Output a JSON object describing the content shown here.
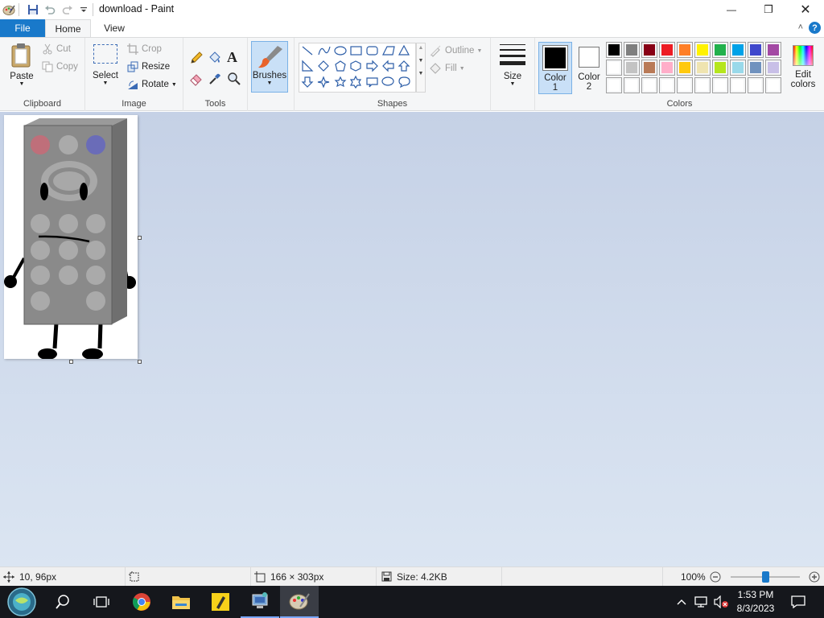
{
  "window": {
    "title": "download - Paint",
    "minimize_glyph": "—",
    "maximize_glyph": "❐",
    "close_glyph": "✕"
  },
  "tabs": {
    "file": "File",
    "home": "Home",
    "view": "View",
    "help": "?",
    "collapse": "˄"
  },
  "ribbon": {
    "clipboard": {
      "label": "Clipboard",
      "paste": "Paste",
      "cut": "Cut",
      "copy": "Copy"
    },
    "image": {
      "label": "Image",
      "select": "Select",
      "crop": "Crop",
      "resize": "Resize",
      "rotate": "Rotate"
    },
    "tools": {
      "label": "Tools"
    },
    "brushes": {
      "label": "Brushes"
    },
    "shapes": {
      "label": "Shapes",
      "outline": "Outline",
      "fill": "Fill"
    },
    "size": {
      "label": "Size"
    },
    "color1": {
      "line1": "Color",
      "line2": "1",
      "value": "#000000"
    },
    "color2": {
      "line1": "Color",
      "line2": "2",
      "value": "#ffffff"
    },
    "colors": {
      "label": "Colors"
    },
    "edit_colors": {
      "line1": "Edit",
      "line2": "colors"
    }
  },
  "palette": {
    "row1": [
      "#000000",
      "#7f7f7f",
      "#880015",
      "#ed1c24",
      "#ff7f27",
      "#fff200",
      "#22b14c",
      "#00a2e8",
      "#3f48cc",
      "#a349a4"
    ],
    "row2": [
      "#ffffff",
      "#c3c3c3",
      "#b97a57",
      "#ffaec9",
      "#ffc90e",
      "#efe4b0",
      "#b5e61d",
      "#99d9ea",
      "#7092be",
      "#c8bfe7"
    ],
    "row3": [
      "#ffffff",
      "#ffffff",
      "#ffffff",
      "#ffffff",
      "#ffffff",
      "#ffffff",
      "#ffffff",
      "#ffffff",
      "#ffffff",
      "#ffffff"
    ]
  },
  "status": {
    "cursor_pos": "10, 96px",
    "selection_size": "",
    "canvas_size": "166 × 303px",
    "file_size": "Size: 4.2KB",
    "zoom": "100%",
    "zoom_fraction": 0.5
  },
  "taskbar": {
    "time": "1:53 PM",
    "date": "8/3/2023"
  }
}
